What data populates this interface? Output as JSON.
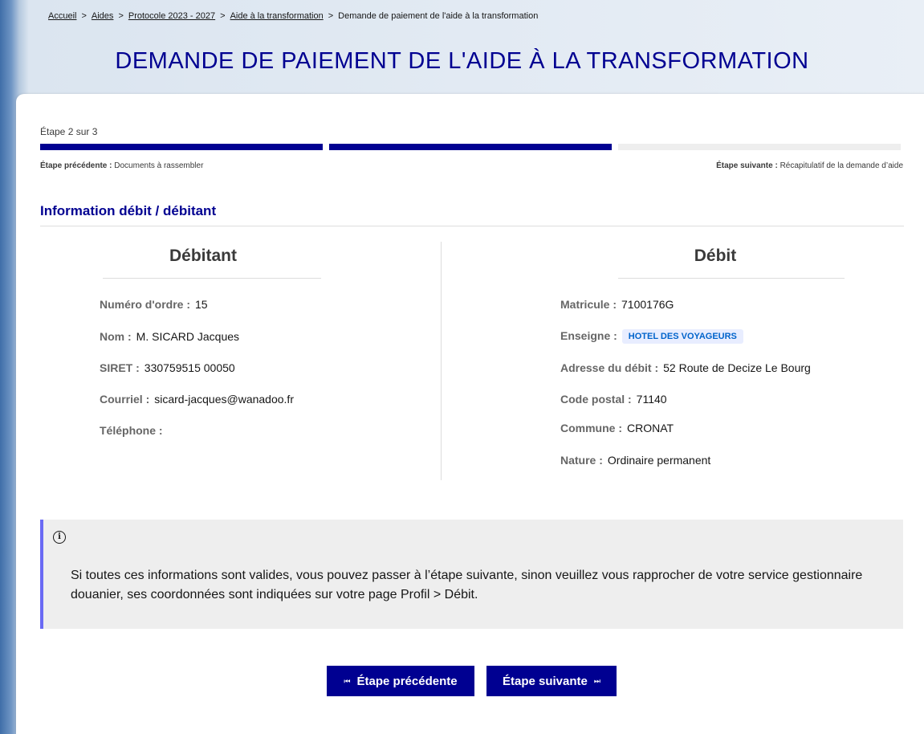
{
  "breadcrumb": {
    "items": [
      "Accueil",
      "Aides",
      "Protocole 2023 - 2027",
      "Aide à la transformation"
    ],
    "separator": ">",
    "current": "Demande de paiement de l'aide à la transformation"
  },
  "page": {
    "title": "DEMANDE DE PAIEMENT DE L'AIDE À LA TRANSFORMATION"
  },
  "stepper": {
    "label": "Étape 2 sur 3",
    "current": 2,
    "total": 3,
    "previous_label": "Étape précédente :",
    "previous_value": "Documents à rassembler",
    "next_label": "Étape suivante :",
    "next_value": "Récapitulatif de la demande d’aide"
  },
  "section": {
    "title": "Information débit / débitant"
  },
  "debitant": {
    "title": "Débitant",
    "fields": [
      {
        "label": "Numéro d'ordre :",
        "value": "15"
      },
      {
        "label": "Nom :",
        "value": "M. SICARD Jacques"
      },
      {
        "label": "SIRET :",
        "value": "330759515 00050"
      },
      {
        "label": "Courriel :",
        "value": "sicard-jacques@wanadoo.fr"
      },
      {
        "label": "Téléphone :",
        "value": ""
      }
    ]
  },
  "debit": {
    "title": "Débit",
    "fields": [
      {
        "label": "Matricule :",
        "value": "7100176G"
      },
      {
        "label": "Enseigne :",
        "value": "HOTEL DES VOYAGEURS"
      },
      {
        "label": "Adresse du débit :",
        "value": "52 Route de Decize Le Bourg"
      },
      {
        "label": "Code postal :",
        "value": "71140"
      },
      {
        "label": "Commune :",
        "value": "CRONAT"
      },
      {
        "label": "Nature :",
        "value": "Ordinaire permanent"
      }
    ]
  },
  "notice": {
    "icon": "info-icon",
    "text": "Si toutes ces informations sont valides, vous pouvez passer à l’étape suivante, sinon veuillez vous rapprocher de votre service gestionnaire douanier, ses coordonnées sont indiquées sur votre page Profil > Débit."
  },
  "buttons": {
    "previous": "Étape précédente",
    "next": "Étape suivante"
  },
  "colors": {
    "primary": "#000091",
    "badge_bg": "#e8edff",
    "badge_text": "#0063cb",
    "notice_border": "#6a6af4"
  }
}
